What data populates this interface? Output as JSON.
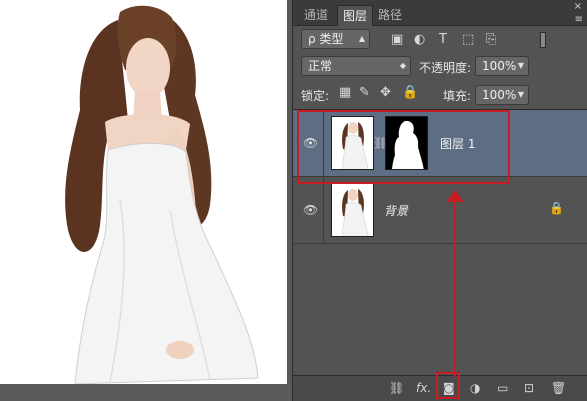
{
  "tabs": [
    {
      "label": "通道",
      "active": false
    },
    {
      "label": "图层",
      "active": true
    },
    {
      "label": "路径",
      "active": false
    }
  ],
  "panel_controls": {
    "close_icon": "×",
    "menu_icon": "≡"
  },
  "filter": {
    "kind_label": "ρ 类型",
    "icons": [
      "image-filter-icon",
      "adjustment-filter-icon",
      "type-filter-icon",
      "shape-filter-icon",
      "smart-object-filter-icon"
    ]
  },
  "blend": {
    "mode": "正常",
    "opacity_label": "不透明度:",
    "opacity_value": "100%"
  },
  "lock": {
    "label": "锁定:",
    "icons": [
      "lock-transparent-icon",
      "lock-image-icon",
      "lock-position-icon",
      "lock-all-icon"
    ],
    "fill_label": "填充:",
    "fill_value": "100%"
  },
  "layers": [
    {
      "name": "图层 1",
      "selected": true,
      "has_mask": true,
      "visible": true
    },
    {
      "name": "背景",
      "selected": false,
      "has_mask": false,
      "visible": true,
      "locked": true
    }
  ],
  "bottom_icons": [
    "link-layers-icon",
    "fx-icon",
    "add-mask-icon",
    "adjustment-layer-icon",
    "group-folder-icon",
    "new-layer-icon",
    "trash-icon"
  ],
  "bottom_labels": {
    "fx": "fx."
  },
  "colors": {
    "selected_row": "#5d6d84",
    "annotation_red": "#c71c24",
    "panel_bg": "#535353"
  }
}
